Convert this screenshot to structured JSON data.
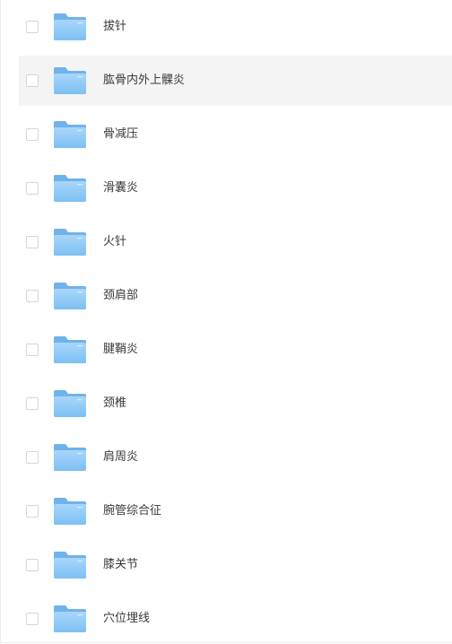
{
  "icons": {
    "checkbox": "checkbox-unchecked",
    "folder": "folder-icon"
  },
  "colors": {
    "folder_back": "#6fb3ea",
    "folder_front_top": "#a9d6fb",
    "folder_front_bottom": "#7cc0f3",
    "row_highlight": "#f4f4f4",
    "text": "#3a3a3a"
  },
  "files": [
    {
      "name": "拔针"
    },
    {
      "name": "肱骨内外上髁炎",
      "hovered": true
    },
    {
      "name": "骨减压"
    },
    {
      "name": "滑囊炎"
    },
    {
      "name": "火针"
    },
    {
      "name": "颈肩部"
    },
    {
      "name": "腱鞘炎"
    },
    {
      "name": "颈椎"
    },
    {
      "name": "肩周炎"
    },
    {
      "name": "腕管综合征"
    },
    {
      "name": "膝关节"
    },
    {
      "name": "穴位埋线"
    }
  ]
}
